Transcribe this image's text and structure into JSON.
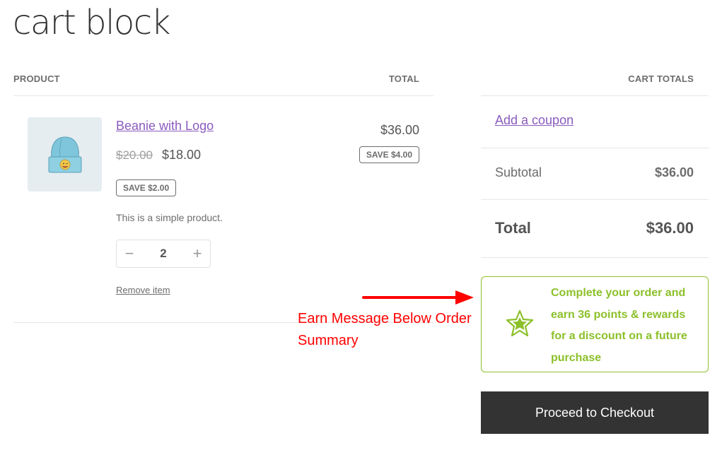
{
  "page": {
    "title": "cart block"
  },
  "cart_table": {
    "headers": {
      "product": "PRODUCT",
      "total": "TOTAL"
    },
    "items": [
      {
        "name": "Beanie with Logo",
        "image_icon": "beanie-image",
        "regular_price": "$20.00",
        "sale_price": "$18.00",
        "item_save_badge": "SAVE $2.00",
        "description": "This is a simple product.",
        "quantity": "2",
        "quantity_decrease_symbol": "−",
        "quantity_increase_symbol": "+",
        "remove_label": "Remove item",
        "line_total": "$36.00",
        "line_save_badge": "SAVE $4.00"
      }
    ]
  },
  "cart_totals": {
    "header": "CART TOTALS",
    "coupon_link": "Add a coupon",
    "subtotal_label": "Subtotal",
    "subtotal_value": "$36.00",
    "total_label": "Total",
    "total_value": "$36.00"
  },
  "earn_message": {
    "icon": "star-icon",
    "text": "Complete your order and earn 36 points & rewards for a discount on a future purchase",
    "accent_color": "#8cc02a"
  },
  "checkout_button": {
    "label": "Proceed to Checkout"
  },
  "annotation": {
    "text": "Earn Message Below Order Summary",
    "color": "#ff0000"
  }
}
